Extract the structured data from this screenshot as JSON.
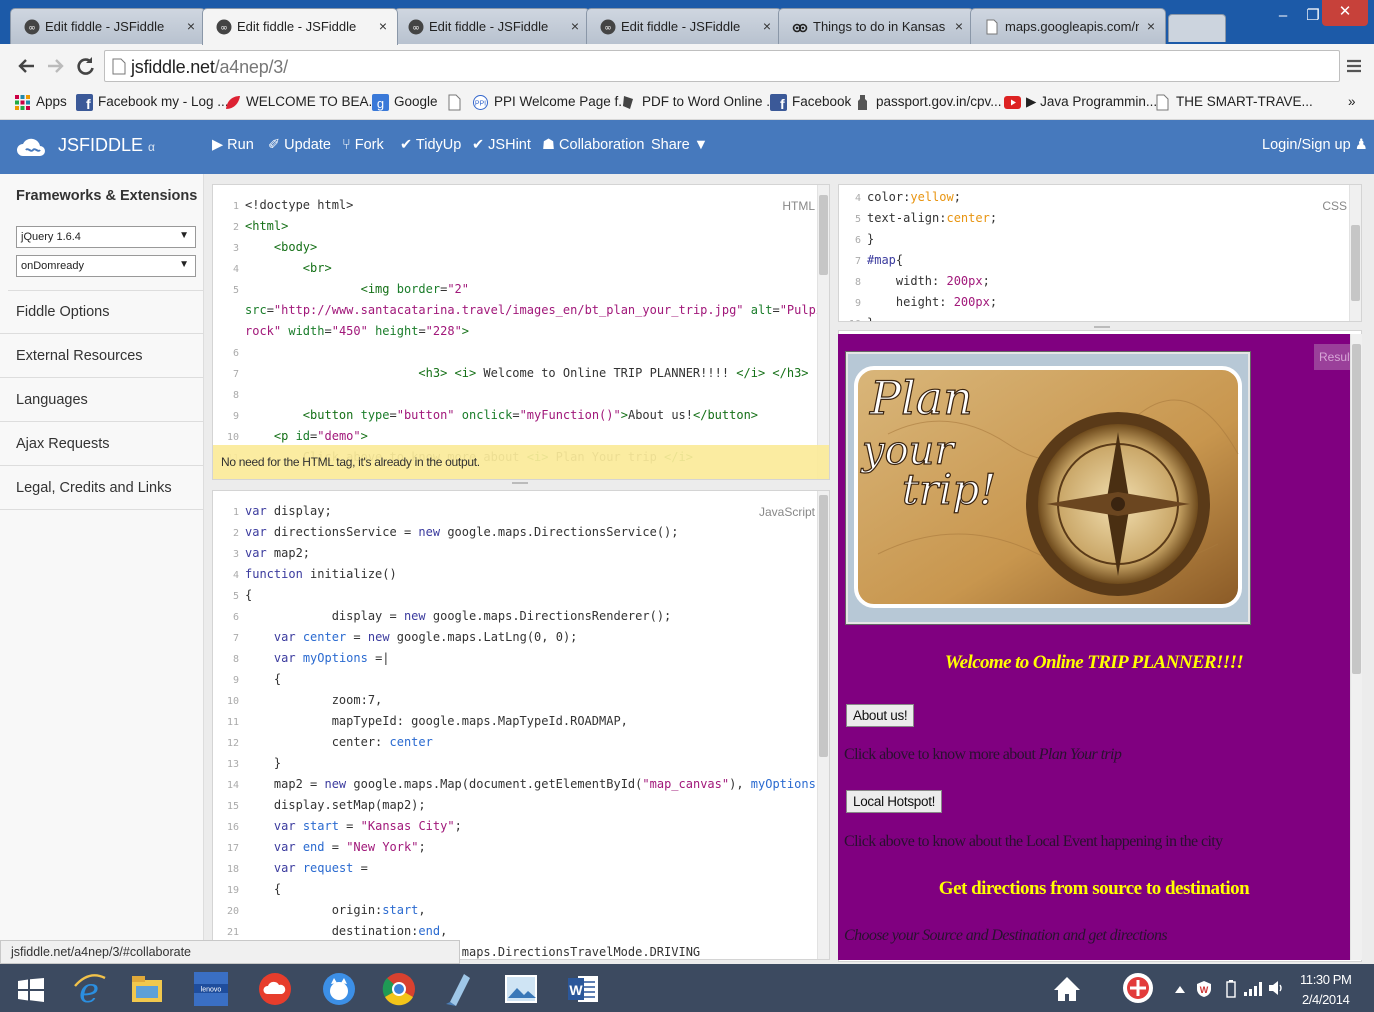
{
  "browser": {
    "tabs": [
      {
        "label": "Edit fiddle - JSFiddle",
        "close": "×"
      },
      {
        "label": "Edit fiddle - JSFiddle",
        "close": "×"
      },
      {
        "label": "Edit fiddle - JSFiddle",
        "close": "×"
      },
      {
        "label": "Edit fiddle - JSFiddle",
        "close": "×"
      },
      {
        "label": "Things to do in Kansas Cit",
        "close": "×"
      },
      {
        "label": "maps.googleapis.com/ma",
        "close": "×"
      }
    ],
    "window_buttons": {
      "minimize": "–",
      "maximize": "❐",
      "close": "✕"
    },
    "address": {
      "host": "jsfiddle.net",
      "path": "/a4nep/3/"
    },
    "bookmarks": [
      {
        "label": "Apps",
        "icon": "apps-grid-icon"
      },
      {
        "label": "Facebook my - Log ...",
        "icon": "facebook-icon"
      },
      {
        "label": "WELCOME TO BEA...",
        "icon": "leaf-icon"
      },
      {
        "label": "Google",
        "icon": "google-icon"
      },
      {
        "label": "",
        "icon": "page-icon"
      },
      {
        "label": "PPI Welcome Page f...",
        "icon": "ppi-icon"
      },
      {
        "label": "PDF to Word Online ...",
        "icon": "pdf-icon"
      },
      {
        "label": "Facebook",
        "icon": "facebook-icon"
      },
      {
        "label": "passport.gov.in/cpv...",
        "icon": "emblem-icon"
      },
      {
        "label": "▶ Java Programmin...",
        "icon": "youtube-icon"
      },
      {
        "label": "THE SMART-TRAVE...",
        "icon": "page-icon"
      }
    ],
    "bookmarks_more": "»",
    "status_url": "jsfiddle.net/a4nep/3/#collaborate"
  },
  "jsfiddle": {
    "logo": "JSFIDDLE",
    "logo_sub": "α",
    "toolbar": [
      {
        "label": "▶ Run"
      },
      {
        "label": "✐ Update"
      },
      {
        "label": "⑂ Fork"
      },
      {
        "label": "✔ TidyUp"
      },
      {
        "label": "✔ JSHint"
      },
      {
        "label": "☗ Collaboration"
      },
      {
        "label": "Share ▼"
      }
    ],
    "login": "Login/Sign up ♟"
  },
  "sidebar": {
    "heading": "Frameworks & Extensions",
    "framework_select": "jQuery 1.6.4",
    "load_select": "onDomready",
    "items": [
      "Fiddle Options",
      "External Resources",
      "Languages",
      "Ajax Requests",
      "Legal, Credits and Links"
    ]
  },
  "html_panel": {
    "label": "HTML",
    "tooltip": "No need for the HTML tag, it's already in the output.",
    "lines": [
      {
        "n": "1",
        "segs": [
          [
            "t",
            "<!doctype html>"
          ]
        ]
      },
      {
        "n": "2",
        "segs": [
          [
            "g",
            "<html>"
          ]
        ]
      },
      {
        "n": "3",
        "segs": [
          [
            "g",
            "    <body>"
          ]
        ]
      },
      {
        "n": "4",
        "segs": [
          [
            "g",
            "        <br>"
          ]
        ]
      },
      {
        "n": "5",
        "segs": [
          [
            "g",
            "                <img "
          ],
          [
            "a",
            "border"
          ],
          [
            "t",
            "="
          ],
          [
            "s",
            "\"2\""
          ]
        ]
      },
      {
        "n": "",
        "segs": [
          [
            "a",
            "src"
          ],
          [
            "t",
            "="
          ],
          [
            "s",
            "\"http://www.santacatarina.travel/images_en/bt_plan_your_trip.jpg\""
          ],
          [
            "t",
            " "
          ],
          [
            "a",
            "alt"
          ],
          [
            "t",
            "="
          ],
          [
            "s",
            "\"Pulpit"
          ]
        ]
      },
      {
        "n": "",
        "segs": [
          [
            "s",
            "rock\""
          ],
          [
            "t",
            " "
          ],
          [
            "a",
            "width"
          ],
          [
            "t",
            "="
          ],
          [
            "s",
            "\"450\""
          ],
          [
            "t",
            " "
          ],
          [
            "a",
            "height"
          ],
          [
            "t",
            "="
          ],
          [
            "s",
            "\"228\""
          ],
          [
            "g",
            ">"
          ]
        ]
      },
      {
        "n": "6",
        "segs": []
      },
      {
        "n": "7",
        "segs": [
          [
            "g",
            "                        <h3> <i>"
          ],
          [
            "t",
            " Welcome to Online TRIP PLANNER!!!! "
          ],
          [
            "g",
            "</i> </h3>"
          ]
        ]
      },
      {
        "n": "8",
        "segs": []
      },
      {
        "n": "9",
        "segs": [
          [
            "g",
            "        <button "
          ],
          [
            "a",
            "type"
          ],
          [
            "t",
            "="
          ],
          [
            "s",
            "\"button\""
          ],
          [
            "t",
            " "
          ],
          [
            "a",
            "onclick"
          ],
          [
            "t",
            "="
          ],
          [
            "s",
            "\"myFunction()\""
          ],
          [
            "g",
            ">"
          ],
          [
            "t",
            "About us!"
          ],
          [
            "g",
            "</button>"
          ]
        ]
      },
      {
        "n": "10",
        "segs": [
          [
            "g",
            "    <p "
          ],
          [
            "a",
            "id"
          ],
          [
            "t",
            "="
          ],
          [
            "s",
            "\"demo\""
          ],
          [
            "g",
            ">"
          ]
        ]
      },
      {
        "n": "11",
        "segs": [
          [
            "t",
            "        Click above to know more about "
          ],
          [
            "g",
            "<i>"
          ],
          [
            "t",
            " Plan Your trip "
          ],
          [
            "g",
            "</i>"
          ]
        ]
      }
    ]
  },
  "css_panel": {
    "label": "CSS",
    "lines": [
      {
        "n": "4",
        "segs": [
          [
            "t",
            "color:"
          ],
          [
            "c",
            "yellow"
          ],
          [
            "t",
            ";"
          ]
        ]
      },
      {
        "n": "5",
        "segs": [
          [
            "t",
            "text-align:"
          ],
          [
            "c",
            "center"
          ],
          [
            "t",
            ";"
          ]
        ]
      },
      {
        "n": "6",
        "segs": [
          [
            "t",
            "}"
          ]
        ]
      },
      {
        "n": "7",
        "segs": [
          [
            "k",
            "#map"
          ],
          [
            "t",
            "{"
          ]
        ]
      },
      {
        "n": "8",
        "segs": [
          [
            "t",
            "    width: "
          ],
          [
            "s",
            "200px"
          ],
          [
            "t",
            ";"
          ]
        ]
      },
      {
        "n": "9",
        "segs": [
          [
            "t",
            "    height: "
          ],
          [
            "s",
            "200px"
          ],
          [
            "t",
            ";"
          ]
        ]
      },
      {
        "n": "10",
        "segs": [
          [
            "t",
            "}"
          ]
        ]
      }
    ]
  },
  "js_panel": {
    "label": "JavaScript",
    "lines": [
      {
        "n": "1",
        "segs": [
          [
            "k",
            "var"
          ],
          [
            "t",
            " display;"
          ]
        ]
      },
      {
        "n": "2",
        "segs": [
          [
            "k",
            "var"
          ],
          [
            "t",
            " directionsService = "
          ],
          [
            "k",
            "new"
          ],
          [
            "t",
            " google.maps.DirectionsService();"
          ]
        ]
      },
      {
        "n": "3",
        "segs": [
          [
            "k",
            "var"
          ],
          [
            "t",
            " map2;"
          ]
        ]
      },
      {
        "n": "4",
        "segs": [
          [
            "k",
            "function"
          ],
          [
            "t",
            " initialize()"
          ]
        ]
      },
      {
        "n": "5",
        "segs": [
          [
            "t",
            "{"
          ]
        ]
      },
      {
        "n": "6",
        "segs": [
          [
            "t",
            "            display = "
          ],
          [
            "k",
            "new"
          ],
          [
            "t",
            " google.maps.DirectionsRenderer();"
          ]
        ]
      },
      {
        "n": "7",
        "segs": [
          [
            "t",
            "    "
          ],
          [
            "k",
            "var"
          ],
          [
            "t",
            " "
          ],
          [
            "v",
            "center"
          ],
          [
            "t",
            " = "
          ],
          [
            "k",
            "new"
          ],
          [
            "t",
            " google.maps.LatLng(0, 0);"
          ]
        ]
      },
      {
        "n": "8",
        "segs": [
          [
            "t",
            "    "
          ],
          [
            "k",
            "var"
          ],
          [
            "t",
            " "
          ],
          [
            "v",
            "myOptions"
          ],
          [
            "t",
            " =|"
          ]
        ]
      },
      {
        "n": "9",
        "segs": [
          [
            "t",
            "    {"
          ]
        ]
      },
      {
        "n": "10",
        "segs": [
          [
            "t",
            "            zoom:7,"
          ]
        ]
      },
      {
        "n": "11",
        "segs": [
          [
            "t",
            "            mapTypeId: google.maps.MapTypeId.ROADMAP,"
          ]
        ]
      },
      {
        "n": "12",
        "segs": [
          [
            "t",
            "            center: "
          ],
          [
            "v",
            "center"
          ]
        ]
      },
      {
        "n": "13",
        "segs": [
          [
            "t",
            "    }"
          ]
        ]
      },
      {
        "n": "14",
        "segs": [
          [
            "t",
            "    map2 = "
          ],
          [
            "k",
            "new"
          ],
          [
            "t",
            " google.maps.Map(document.getElementById("
          ],
          [
            "s",
            "\"map_canvas\""
          ],
          [
            "t",
            "), "
          ],
          [
            "v",
            "myOptions"
          ],
          [
            "t",
            ");"
          ]
        ]
      },
      {
        "n": "15",
        "segs": [
          [
            "t",
            "    display.setMap(map2);"
          ]
        ]
      },
      {
        "n": "16",
        "segs": [
          [
            "t",
            "    "
          ],
          [
            "k",
            "var"
          ],
          [
            "t",
            " "
          ],
          [
            "v",
            "start"
          ],
          [
            "t",
            " = "
          ],
          [
            "s",
            "\"Kansas City\""
          ],
          [
            "t",
            ";"
          ]
        ]
      },
      {
        "n": "17",
        "segs": [
          [
            "t",
            "    "
          ],
          [
            "k",
            "var"
          ],
          [
            "t",
            " "
          ],
          [
            "v",
            "end"
          ],
          [
            "t",
            " = "
          ],
          [
            "s",
            "\"New York\""
          ],
          [
            "t",
            ";"
          ]
        ]
      },
      {
        "n": "18",
        "segs": [
          [
            "t",
            "    "
          ],
          [
            "k",
            "var"
          ],
          [
            "t",
            " "
          ],
          [
            "v",
            "request"
          ],
          [
            "t",
            " ="
          ]
        ]
      },
      {
        "n": "19",
        "segs": [
          [
            "t",
            "    {"
          ]
        ]
      },
      {
        "n": "20",
        "segs": [
          [
            "t",
            "            origin:"
          ],
          [
            "v",
            "start"
          ],
          [
            "t",
            ","
          ]
        ]
      },
      {
        "n": "21",
        "segs": [
          [
            "t",
            "            destination:"
          ],
          [
            "v",
            "end"
          ],
          [
            "t",
            ","
          ]
        ]
      },
      {
        "n": "",
        "segs": [
          [
            "t",
            "                              maps.DirectionsTravelMode.DRIVING"
          ]
        ]
      }
    ]
  },
  "result": {
    "label": "Result",
    "image_text": [
      "Plan",
      "your",
      "trip!"
    ],
    "heading": "Welcome to Online TRIP PLANNER!!!!",
    "about_button": "About us!",
    "about_text": "Click above to know more about",
    "about_italic": "Plan Your trip",
    "hotspot_button": "Local Hotspot!",
    "hotspot_text": "Click above to know about the Local Event happening in the city",
    "directions_heading": "Get directions from source to destination",
    "directions_sub": "Choose your Source and Destination and get directions"
  },
  "taskbar": {
    "time": "11:30 PM",
    "date": "2/4/2014"
  },
  "colors": {
    "jsfiddle_blue": "#4679bd",
    "result_bg": "#800080",
    "result_heading": "#ffff00",
    "tooltip_bg": "#fbeb9a",
    "chrome_frame": "#1c5aa8"
  }
}
